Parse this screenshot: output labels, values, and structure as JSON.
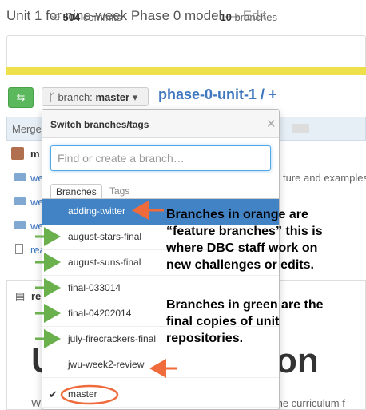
{
  "repo": {
    "description": "Unit 1 for nine-week Phase 0 model",
    "edit_label": "— Edit",
    "commits_count": "504",
    "commits_label": "commits",
    "branches_count": "10",
    "branches_label": "branches",
    "path_name": "phase-0-unit-1",
    "path_sep": "/ +"
  },
  "branch_button": {
    "prefix": "branch:",
    "current": "master"
  },
  "background": {
    "merge_text": "Merge",
    "author_initial": "m",
    "file_snippet": "ture and examples",
    "file_prefixes": [
      "we",
      "we",
      "we",
      "rea"
    ],
    "readme_prefix": "re",
    "heading_left": "U",
    "heading_right": "on",
    "footer_left": "W",
    "footer_right": "the curriculum f"
  },
  "dropdown": {
    "title": "Switch branches/tags",
    "search_placeholder": "Find or create a branch…",
    "tab_branches": "Branches",
    "tab_tags": "Tags",
    "items": [
      "adding-twitter",
      "august-stars-final",
      "august-suns-final",
      "final-033014",
      "final-04202014",
      "july-firecrackers-final",
      "jwu-week2-review",
      "master"
    ]
  },
  "annotations": {
    "orange": [
      "Branches in orange are",
      "“feature branches” this is",
      "where DBC staff work on",
      "new challenges or edits."
    ],
    "green": [
      "Branches in green are the",
      "final copies of unit",
      "repositories."
    ]
  },
  "colors": {
    "orange_arrow": "#ef6b3c",
    "green_arrow": "#6ab04c",
    "selected_bg": "#4183c4",
    "language_bar": "#ede04a"
  }
}
